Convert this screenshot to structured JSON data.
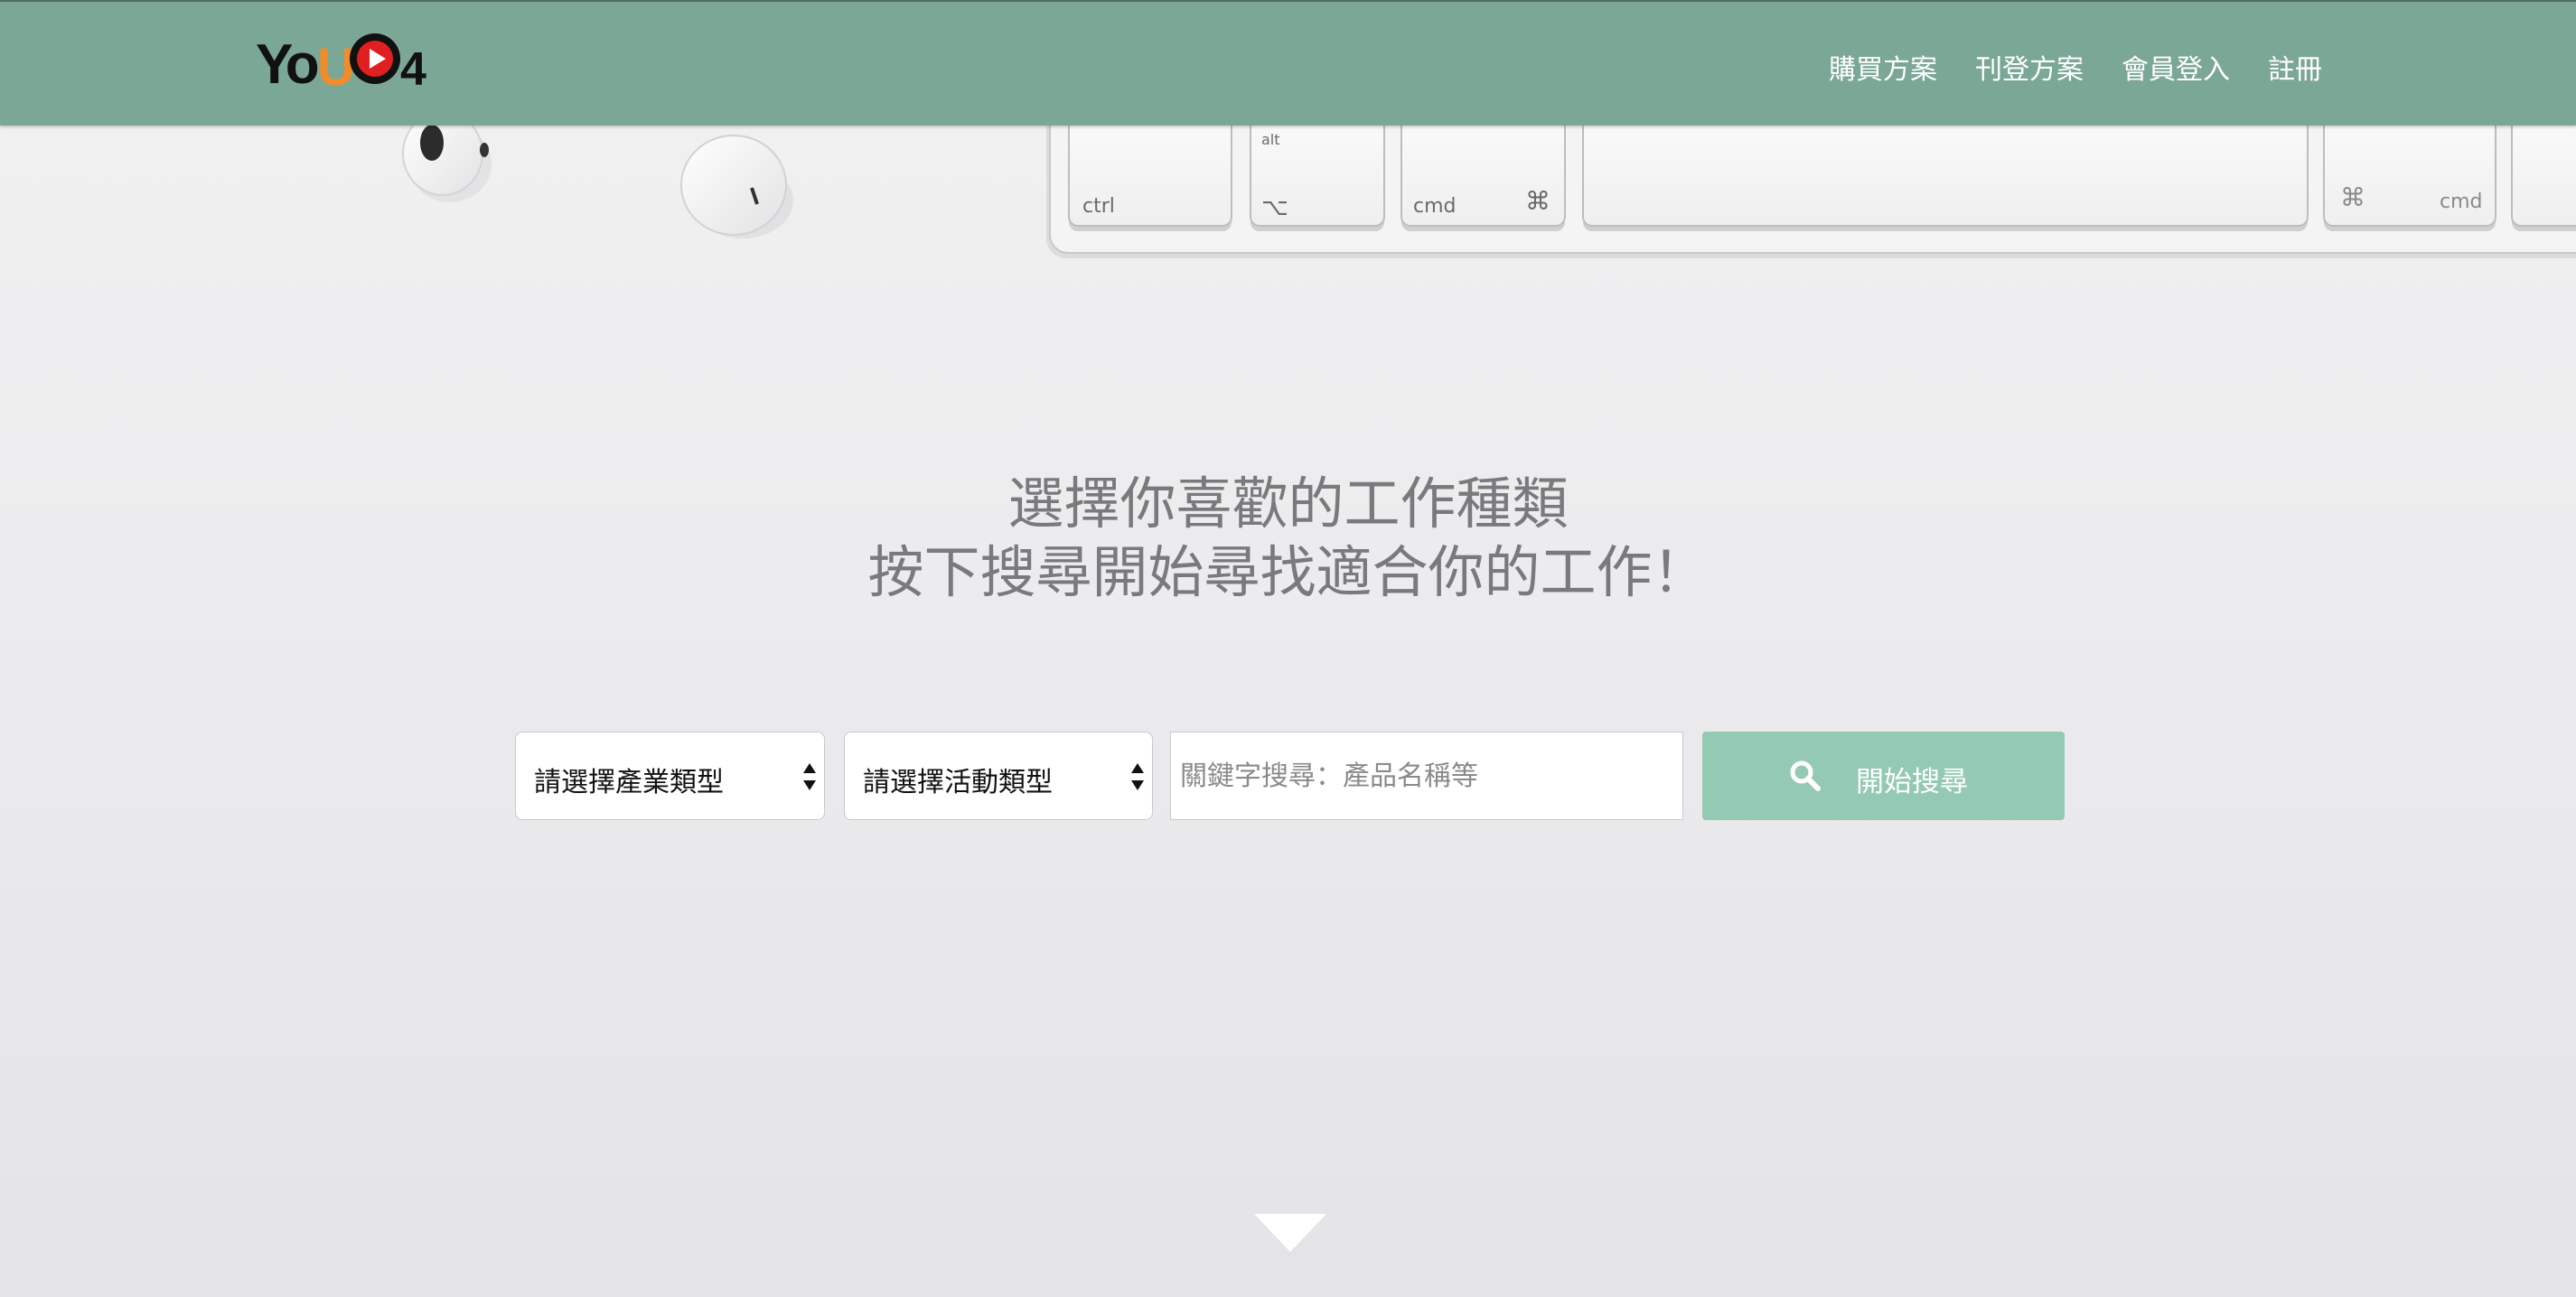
{
  "brand": {
    "logo_text": "YoU04",
    "colors": {
      "header": "#7ba796",
      "button": "#94c9b4",
      "logo_orange": "#f28c28",
      "logo_red": "#e02020"
    }
  },
  "nav": {
    "items": [
      "購買方案",
      "刊登方案",
      "會員登入",
      "註冊"
    ]
  },
  "hero": {
    "line1": "選擇你喜歡的工作種類",
    "line2": "按下搜尋開始尋找適合你的工作！"
  },
  "search": {
    "industry_select": "請選擇產業類型",
    "activity_select": "請選擇活動類型",
    "keyword_placeholder": "關鍵字搜尋：產品名稱等",
    "button_label": "開始搜尋",
    "button_icon": "search-icon"
  },
  "keyboard": {
    "keys": [
      "ctrl",
      "alt",
      "⌥",
      "cmd",
      "⌘",
      "⌘",
      "cmd"
    ]
  },
  "scroll": {
    "icon": "chevron-down-icon"
  }
}
